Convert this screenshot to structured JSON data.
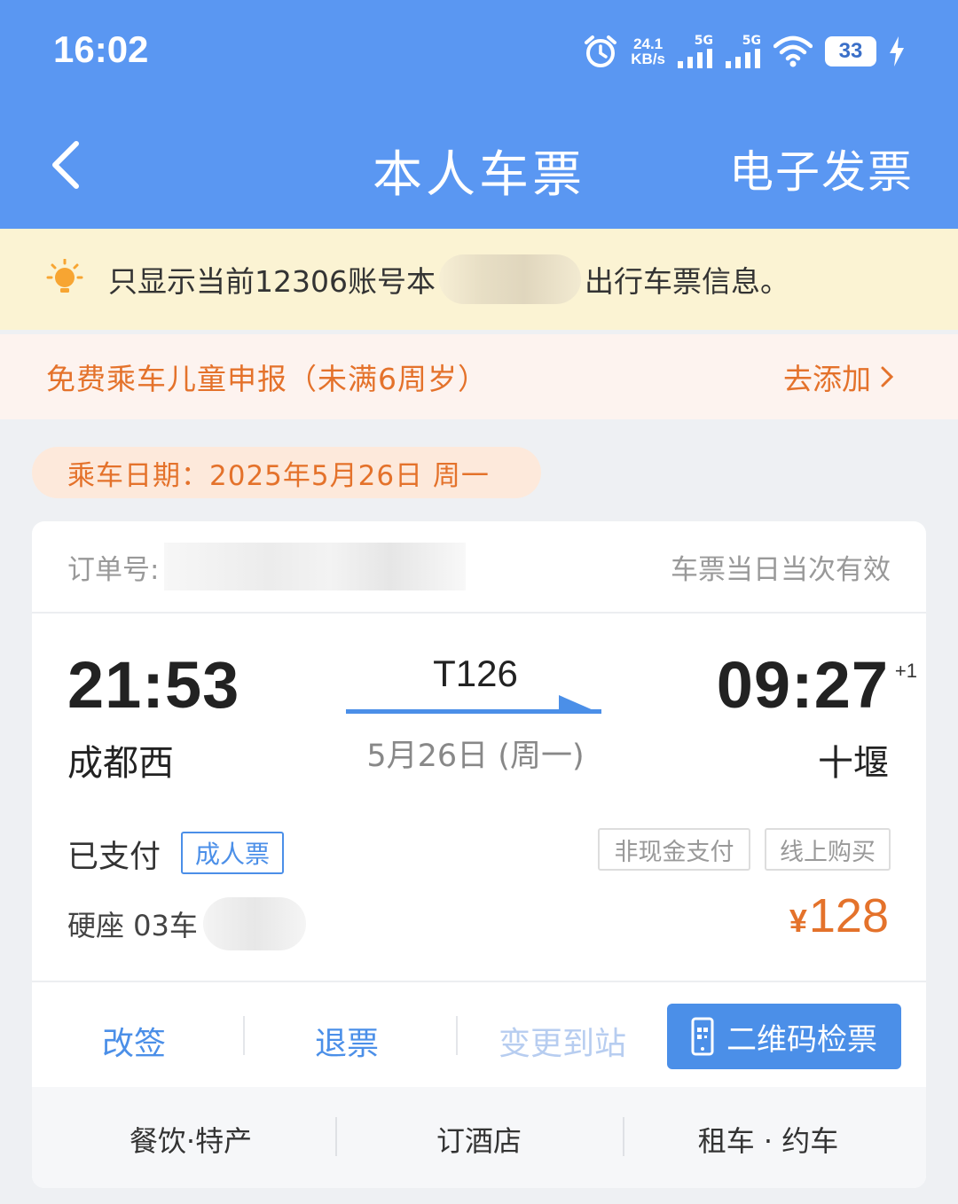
{
  "status_bar": {
    "time": "16:02",
    "net_speed_value": "24.1",
    "net_speed_unit": "KB/s",
    "sim1_label": "5G",
    "sim2_label": "5G",
    "battery": "33"
  },
  "header": {
    "title": "本人车票",
    "invoice_link": "电子发票"
  },
  "notice": {
    "text_before": "只显示当前12306账号本",
    "text_after": "出行车票信息。"
  },
  "child_report": {
    "title": "免费乘车儿童申报（未满6周岁）",
    "action": "去添加"
  },
  "travel_date": "乘车日期：2025年5月26日 周一",
  "ticket": {
    "order_label": "订单号:",
    "validity": "车票当日当次有效",
    "departure_time": "21:53",
    "departure_station": "成都西",
    "train_number": "T126",
    "train_date": "5月26日 (周一)",
    "arrival_time": "09:27",
    "arrival_day_offset": "+1",
    "arrival_station": "十堰",
    "payment_status": "已支付",
    "ticket_type": "成人票",
    "tag_payment": "非现金支付",
    "tag_channel": "线上购买",
    "seat": "硬座 03车",
    "price_currency": "¥",
    "price": "128"
  },
  "actions": {
    "change": "改签",
    "refund": "退票",
    "change_station": "变更到站",
    "qr_check": "二维码检票"
  },
  "services": {
    "food": "餐饮·特产",
    "hotel": "订酒店",
    "car": "租车 · 约车"
  },
  "colors": {
    "header_blue": "#5a97f2",
    "accent_blue": "#4b8fe8",
    "orange": "#e4722b",
    "notice_bg": "#fbf3d3"
  }
}
